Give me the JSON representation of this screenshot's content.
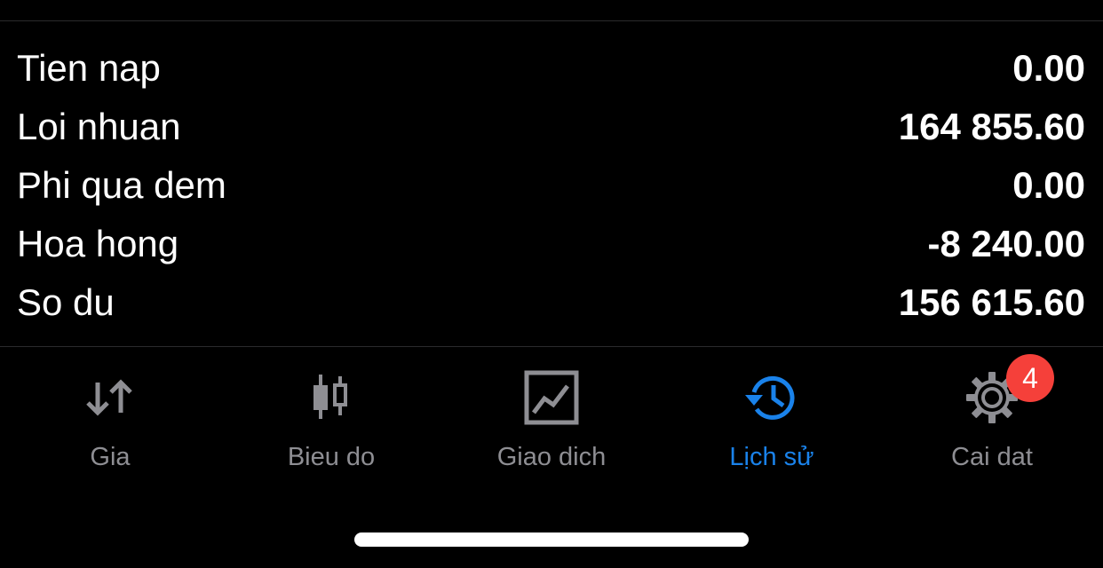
{
  "summary": {
    "rows": [
      {
        "label": "Tien nap",
        "value": "0.00"
      },
      {
        "label": "Loi nhuan",
        "value": "164 855.60"
      },
      {
        "label": "Phi qua dem",
        "value": "0.00"
      },
      {
        "label": "Hoa hong",
        "value": "-8 240.00"
      },
      {
        "label": "So du",
        "value": "156 615.60"
      }
    ]
  },
  "tabbar": {
    "tabs": [
      {
        "label": "Gia",
        "icon": "quotes-arrows-icon",
        "active": false
      },
      {
        "label": "Bieu do",
        "icon": "candlestick-chart-icon",
        "active": false
      },
      {
        "label": "Giao dich",
        "icon": "trade-chart-icon",
        "active": false
      },
      {
        "label": "Lịch sử",
        "icon": "history-clock-icon",
        "active": true
      },
      {
        "label": "Cai dat",
        "icon": "gear-icon",
        "active": false,
        "badge": "4"
      }
    ]
  },
  "colors": {
    "background": "#000000",
    "text": "#ffffff",
    "inactive": "#8e8e93",
    "accent": "#1a82ea",
    "badge": "#f5403a"
  }
}
